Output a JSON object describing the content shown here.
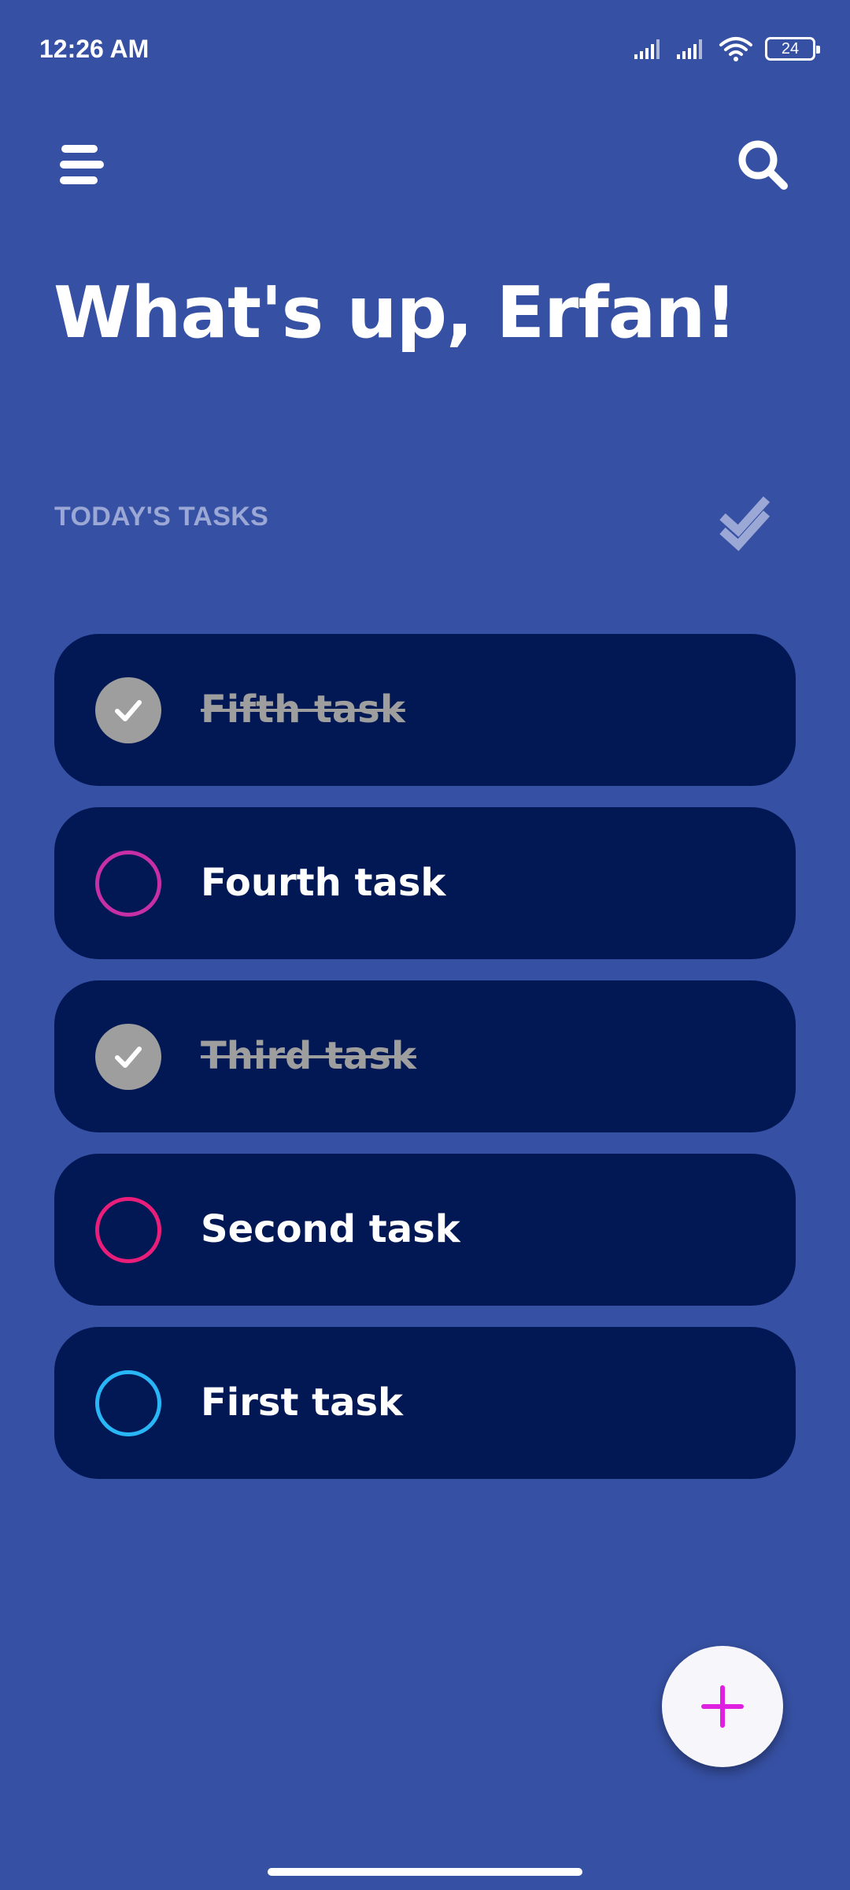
{
  "status_bar": {
    "time": "12:26 AM",
    "battery_level": "24",
    "icons": [
      "signal-icon",
      "signal-icon",
      "wifi-icon",
      "battery-icon"
    ]
  },
  "header": {
    "menu_icon": "menu-icon",
    "search_icon": "search-icon"
  },
  "greeting": "What's up, Erfan!",
  "tasks_section": {
    "label": "TODAY'S TASKS",
    "action_icon": "double-check-icon"
  },
  "tasks": [
    {
      "label": "Fifth task",
      "done": true,
      "color": "#9e9e9e"
    },
    {
      "label": "Fourth task",
      "done": false,
      "color": "#c62fa5"
    },
    {
      "label": "Third task",
      "done": true,
      "color": "#9e9e9e"
    },
    {
      "label": "Second task",
      "done": false,
      "color": "#e91e7a"
    },
    {
      "label": "First task",
      "done": false,
      "color": "#29b6f6"
    }
  ],
  "fab": {
    "icon": "plus-icon",
    "icon_color": "#e020e0"
  },
  "colors": {
    "background": "#3650a3",
    "card": "#021855",
    "section_label": "#9ba8d6"
  }
}
